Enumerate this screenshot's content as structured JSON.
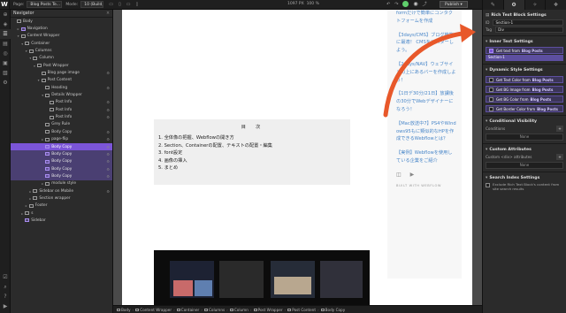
{
  "topbar": {
    "logo": "W",
    "page_label": "Page:",
    "page_value": "Blog Posts Te...",
    "mode_label": "Mode:",
    "mode_value": "10 (Build, –)",
    "dims": "1097 PX",
    "zoom": "100 %",
    "publish": "Publish ▾"
  },
  "navigator": {
    "title": "Navigator",
    "close": "×",
    "rows": [
      {
        "label": "Body",
        "indent": 0,
        "caret": "",
        "sym": false,
        "gear": false,
        "state": ""
      },
      {
        "label": "Navigation",
        "indent": 1,
        "caret": "▸",
        "sym": true,
        "gear": false,
        "state": ""
      },
      {
        "label": "Content Wrapper",
        "indent": 1,
        "caret": "▾",
        "sym": false,
        "gear": false,
        "state": ""
      },
      {
        "label": "Container",
        "indent": 2,
        "caret": "▾",
        "sym": false,
        "gear": false,
        "state": ""
      },
      {
        "label": "Columns",
        "indent": 3,
        "caret": "▾",
        "sym": false,
        "gear": false,
        "state": ""
      },
      {
        "label": "Column",
        "indent": 4,
        "caret": "▾",
        "sym": false,
        "gear": false,
        "state": ""
      },
      {
        "label": "Post Wrapper",
        "indent": 5,
        "caret": "▾",
        "sym": false,
        "gear": false,
        "state": ""
      },
      {
        "label": "Blog page image",
        "indent": 6,
        "caret": "",
        "sym": false,
        "gear": true,
        "state": ""
      },
      {
        "label": "Post Content",
        "indent": 6,
        "caret": "▾",
        "sym": false,
        "gear": false,
        "state": ""
      },
      {
        "label": "Heading",
        "indent": 7,
        "caret": "",
        "sym": false,
        "gear": true,
        "state": ""
      },
      {
        "label": "Details Wrapper",
        "indent": 7,
        "caret": "▾",
        "sym": false,
        "gear": false,
        "state": ""
      },
      {
        "label": "Post Info",
        "indent": 8,
        "caret": "",
        "sym": false,
        "gear": true,
        "state": ""
      },
      {
        "label": "Post Info",
        "indent": 8,
        "caret": "",
        "sym": false,
        "gear": true,
        "state": ""
      },
      {
        "label": "Post Info",
        "indent": 8,
        "caret": "",
        "sym": false,
        "gear": true,
        "state": ""
      },
      {
        "label": "Grey Rule",
        "indent": 7,
        "caret": "",
        "sym": false,
        "gear": false,
        "state": ""
      },
      {
        "label": "Body Copy",
        "indent": 7,
        "caret": "",
        "sym": false,
        "gear": true,
        "state": ""
      },
      {
        "label": "page-flip",
        "indent": 7,
        "caret": "▸",
        "sym": false,
        "gear": true,
        "state": ""
      },
      {
        "label": "Body Copy",
        "indent": 7,
        "caret": "",
        "sym": true,
        "gear": true,
        "state": "selected"
      },
      {
        "label": "Body Copy",
        "indent": 7,
        "caret": "",
        "sym": true,
        "gear": true,
        "state": "sel-child"
      },
      {
        "label": "Body Copy",
        "indent": 7,
        "caret": "",
        "sym": true,
        "gear": true,
        "state": "sel-child"
      },
      {
        "label": "Body Copy",
        "indent": 7,
        "caret": "",
        "sym": true,
        "gear": true,
        "state": "sel-child"
      },
      {
        "label": "Body Copy",
        "indent": 7,
        "caret": "",
        "sym": true,
        "gear": true,
        "state": "sel-child"
      },
      {
        "label": "module style",
        "indent": 7,
        "caret": "▸",
        "sym": false,
        "gear": false,
        "state": ""
      },
      {
        "label": "Sidebar on Mobile",
        "indent": 4,
        "caret": "▸",
        "sym": false,
        "gear": true,
        "state": ""
      },
      {
        "label": "Section wrapper",
        "indent": 4,
        "caret": "▸",
        "sym": false,
        "gear": false,
        "state": ""
      },
      {
        "label": "Footer",
        "indent": 3,
        "caret": "▸",
        "sym": false,
        "gear": false,
        "state": ""
      },
      {
        "label": "s",
        "indent": 2,
        "caret": "▸",
        "sym": false,
        "gear": false,
        "state": ""
      },
      {
        "label": "Sidebar",
        "indent": 2,
        "caret": "",
        "sym": true,
        "gear": false,
        "state": ""
      }
    ]
  },
  "canvas": {
    "toc_title": "目　次",
    "toc_items": [
      "1. 全体像の把握、Webflowの開き方",
      "2. Section、Containerの配置、テキストの配置・編集",
      "3. font設定",
      "4. 画像の挿入",
      "5. まとめ"
    ],
    "side_links": [
      "formだけで簡単にコンタクトフォームを作成",
      "【3days/CMS】ブログ機能に最適！ CMSをマスターしよう。",
      "【2days/NAV】ウェブサイトの上にあるバーを作成しよう！",
      "【1日デ30分/21日】放課後の30分でWebデザイナーになろう！",
      "【Mac放送中7】PS4やWindows95もに類似的なHPを作成できるWebflowとは？",
      "【実例】Webflowを使用している企業をご紹介"
    ],
    "built_with": "BUILT WITH WEBFLOW"
  },
  "breadcrumbs": [
    "Body",
    "Content Wrapper",
    "Container",
    "Columns",
    "Column",
    "Post Wrapper",
    "Post Content",
    "Body Copy"
  ],
  "right_panel": {
    "element_title": "Rich Text Block Settings",
    "id_label": "ID",
    "id_value": "Section-1",
    "tag_label": "Tag",
    "tag_value": "Div",
    "inner_text_title": "Inner Text Settings",
    "inner_bind_prefix": "Get text from",
    "inner_bind_source": "Blog Posts",
    "inner_bind_field": "Section-1",
    "dynamic_title": "Dynamic Style Settings",
    "dynamic_items": [
      {
        "prefix": "Get Text Color from",
        "source": "Blog Posts"
      },
      {
        "prefix": "Get BG Image from",
        "source": "Blog Posts"
      },
      {
        "prefix": "Get BG Color from",
        "source": "Blog Posts"
      },
      {
        "prefix": "Get Border Color from",
        "source": "Blog Posts"
      }
    ],
    "cond_title": "Conditional Visibility",
    "cond_label": "Conditions",
    "cond_none": "None",
    "attr_title": "Custom Attributes",
    "attr_label": "Custom <div> attributes",
    "attr_none": "None",
    "search_title": "Search Index Settings",
    "search_check_label": "Exclude Rich Text Block's content from site search results"
  },
  "colors": {
    "accent": "#7b55d8",
    "arrow": "#e8582a",
    "link": "#4a87c9",
    "status": "#5fcf6c"
  }
}
